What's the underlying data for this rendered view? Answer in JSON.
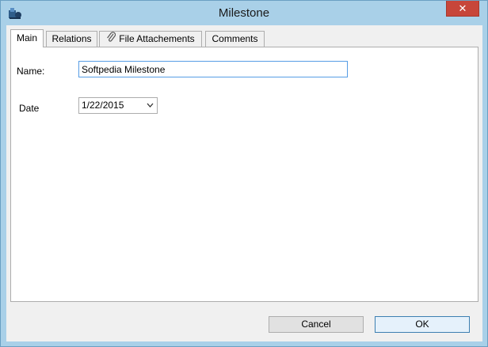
{
  "window": {
    "title": "Milestone",
    "close_glyph": "✕",
    "app_icon": "milestone-app-icon"
  },
  "tabs": [
    {
      "label": "Main",
      "active": true
    },
    {
      "label": "Relations",
      "active": false
    },
    {
      "label": "File Attachements",
      "active": false,
      "icon": "paperclip-icon"
    },
    {
      "label": "Comments",
      "active": false
    }
  ],
  "form": {
    "name_label": "Name:",
    "name_value": "Softpedia Milestone",
    "date_label": "Date",
    "date_value": "1/22/2015"
  },
  "buttons": {
    "cancel": "Cancel",
    "ok": "OK"
  },
  "colors": {
    "frame": "#a9d0e8",
    "close": "#c7463a",
    "focus_border": "#569de5"
  }
}
